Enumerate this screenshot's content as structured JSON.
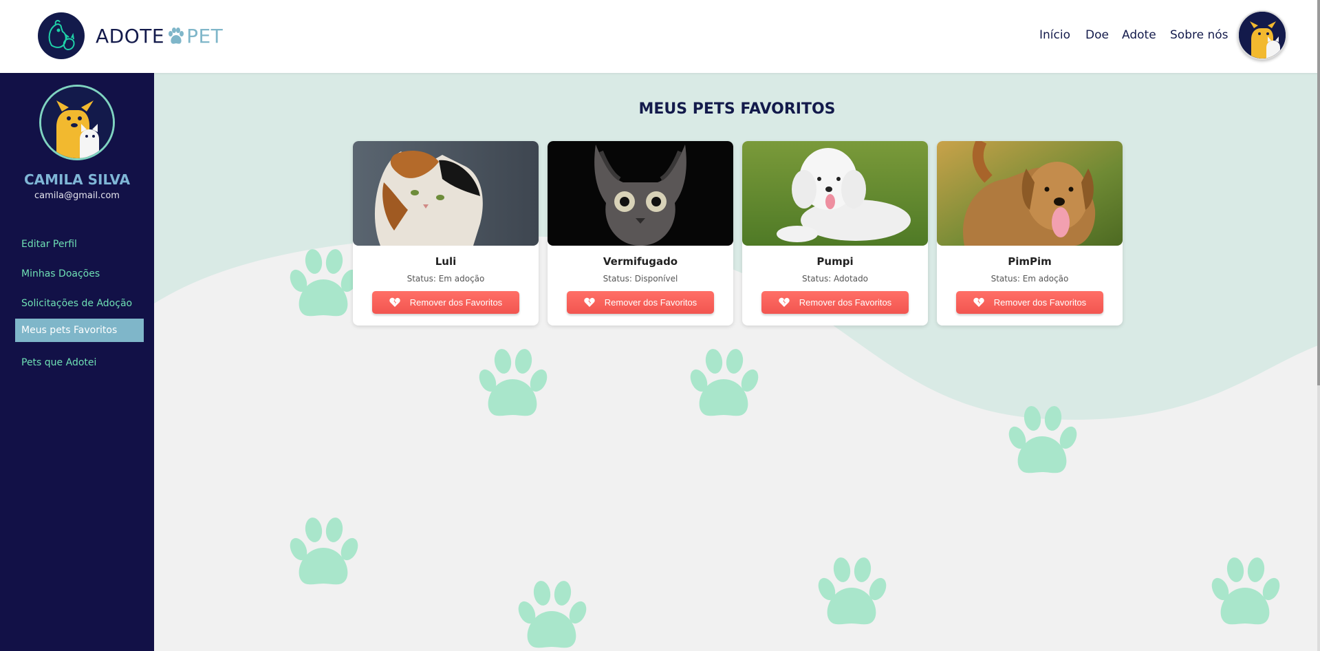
{
  "header": {
    "brand_left": "ADOTE",
    "brand_right": "PET",
    "nav": [
      {
        "label": "Início"
      },
      {
        "label": "Doe"
      },
      {
        "label": "Adote"
      },
      {
        "label": "Sobre nós"
      }
    ]
  },
  "sidebar": {
    "user_name": "CAMILA SILVA",
    "user_email": "camila@gmail.com",
    "items": [
      {
        "label": "Editar Perfil"
      },
      {
        "label": "Minhas Doações"
      },
      {
        "label": "Solicitações de Adoção"
      },
      {
        "label": "Meus pets Favoritos",
        "active": true
      },
      {
        "label": "Pets que Adotei"
      }
    ]
  },
  "main": {
    "title": "MEUS PETS FAVORITOS",
    "cards": [
      {
        "name": "Luli",
        "status": "Status: Em adoção",
        "button": "Remover dos Favoritos"
      },
      {
        "name": "Vermifugado",
        "status": "Status: Disponível",
        "button": "Remover dos Favoritos"
      },
      {
        "name": "Pumpi",
        "status": "Status: Adotado",
        "button": "Remover dos Favoritos"
      },
      {
        "name": "PimPim",
        "status": "Status: Em adoção",
        "button": "Remover dos Favoritos"
      }
    ]
  },
  "colors": {
    "navy": "#131a4b",
    "sidebar_bg": "#121147",
    "accent_blue": "#7fb6c9",
    "mint": "#6fe0b4",
    "paw_green": "#a9e6cb",
    "wave": "#d9eae5",
    "button_red": "#f25550"
  }
}
